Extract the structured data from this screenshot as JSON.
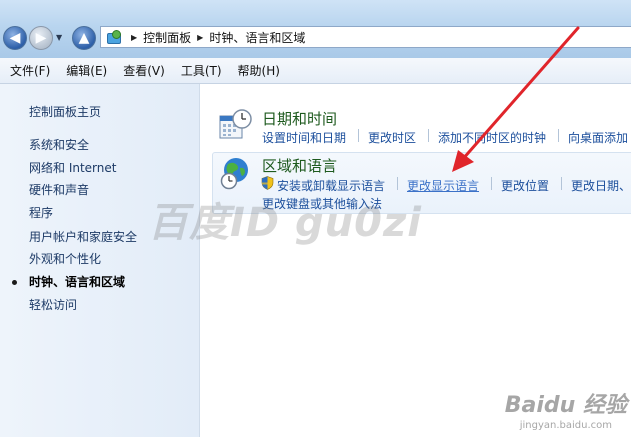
{
  "address": {
    "crumbs": [
      "控制面板",
      "时钟、语言和区域"
    ]
  },
  "menu": [
    "文件(F)",
    "编辑(E)",
    "查看(V)",
    "工具(T)",
    "帮助(H)"
  ],
  "sidebar": {
    "items": [
      {
        "label": "控制面板主页"
      },
      {
        "label": "系统和安全"
      },
      {
        "label": "网络和 Internet"
      },
      {
        "label": "硬件和声音"
      },
      {
        "label": "程序"
      },
      {
        "label": "用户帐户和家庭安全"
      },
      {
        "label": "外观和个性化"
      },
      {
        "label": "时钟、语言和区域",
        "current": true
      },
      {
        "label": "轻松访问"
      }
    ]
  },
  "content": {
    "datetime": {
      "title": "日期和时间",
      "icon": "calendar-clock-icon",
      "tasks": [
        "设置时间和日期",
        "更改时区",
        "添加不同时区的时钟",
        "向桌面添加"
      ]
    },
    "region": {
      "title": "区域和语言",
      "icon": "globe-clock-icon",
      "tasks": [
        "安装或卸载显示语言",
        "更改显示语言",
        "更改位置",
        "更改日期、",
        "更改键盘或其他输入法"
      ]
    }
  },
  "overlays": {
    "watermark": "百度ID gu0zi",
    "baidu_logo": "Baidu 经验",
    "baidu_url": "jingyan.baidu.com",
    "arrow_color": "#e0252b"
  }
}
